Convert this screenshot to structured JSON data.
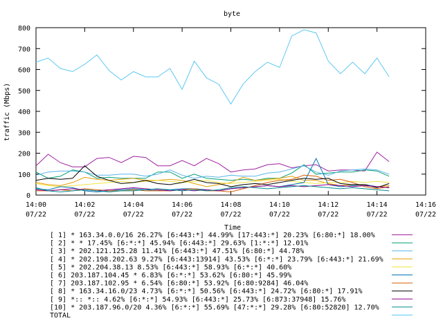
{
  "chart_data": {
    "type": "line",
    "title": "byte",
    "xlabel": "Time",
    "ylabel": "traffic (Mbps)",
    "ylim": [
      0,
      800
    ],
    "xlim": [
      "14:00",
      "14:16"
    ],
    "y_ticks": [
      0,
      100,
      200,
      300,
      400,
      500,
      600,
      700,
      800
    ],
    "x_ticks": [
      {
        "t": "14:00",
        "line2": "07/22"
      },
      {
        "t": "14:02",
        "line2": "07/22"
      },
      {
        "t": "14:04",
        "line2": "07/22"
      },
      {
        "t": "14:06",
        "line2": "07/22"
      },
      {
        "t": "14:08",
        "line2": "07/22"
      },
      {
        "t": "14:10",
        "line2": "07/22"
      },
      {
        "t": "14:12",
        "line2": "07/22"
      },
      {
        "t": "14:14",
        "line2": "07/22"
      },
      {
        "t": "14:16",
        "line2": "07/22"
      }
    ],
    "x": [
      "14:00:00",
      "14:00:30",
      "14:01:00",
      "14:01:30",
      "14:02:00",
      "14:02:30",
      "14:03:00",
      "14:03:30",
      "14:04:00",
      "14:04:30",
      "14:05:00",
      "14:05:30",
      "14:06:00",
      "14:06:30",
      "14:07:00",
      "14:07:30",
      "14:08:00",
      "14:08:30",
      "14:09:00",
      "14:09:30",
      "14:10:00",
      "14:10:30",
      "14:11:00",
      "14:11:30",
      "14:12:00",
      "14:12:30",
      "14:13:00",
      "14:13:30",
      "14:14:00",
      "14:14:30"
    ],
    "grid": false,
    "legend_position": "bottom",
    "series": [
      {
        "name": "[ 1] * 163.34.0.0/16 26.27%  [6:443:*] 44.99% [17:443:*] 20.23% [6:80:*] 18.00%",
        "color": "#a020a0",
        "values": [
          140,
          195,
          155,
          135,
          135,
          175,
          180,
          155,
          185,
          180,
          140,
          140,
          165,
          140,
          175,
          150,
          110,
          120,
          125,
          145,
          150,
          130,
          140,
          145,
          115,
          120,
          120,
          115,
          205,
          160
        ]
      },
      {
        "name": "[ 2] * * 17.45%  [6:*:*] 45.94% [6:443:*] 29.63% [1:*:*] 12.01%",
        "color": "#009e73",
        "values": [
          110,
          80,
          90,
          120,
          110,
          80,
          85,
          80,
          80,
          80,
          110,
          110,
          80,
          100,
          80,
          75,
          70,
          75,
          70,
          80,
          80,
          105,
          145,
          100,
          105,
          110,
          110,
          120,
          115,
          90
        ]
      },
      {
        "name": "[ 3] * 202.121.125.28 11.41%  [6:443:*] 47.51% [6:80:*] 44.78%",
        "color": "#56b4e9",
        "values": [
          95,
          110,
          115,
          115,
          110,
          95,
          95,
          100,
          100,
          90,
          100,
          120,
          95,
          80,
          90,
          85,
          95,
          90,
          90,
          105,
          110,
          125,
          140,
          110,
          95,
          115,
          120,
          125,
          120,
          100
        ]
      },
      {
        "name": "[ 4] * 202.198.202.63 9.27%  [6:443:13914] 43.53% [6:*:*] 23.79% [6:443:*] 21.69%",
        "color": "#e69f00",
        "values": [
          60,
          50,
          45,
          60,
          85,
          75,
          70,
          75,
          80,
          70,
          70,
          75,
          70,
          55,
          40,
          50,
          60,
          85,
          70,
          75,
          80,
          90,
          70,
          70,
          55,
          45,
          50,
          45,
          40,
          45
        ]
      },
      {
        "name": "[ 5] * 202.204.38.13 8.53%  [6:443:*] 58.93% [6:*:*] 40.60%",
        "color": "#f0e442",
        "values": [
          55,
          45,
          40,
          45,
          50,
          55,
          60,
          65,
          60,
          65,
          70,
          65,
          60,
          65,
          70,
          60,
          55,
          60,
          65,
          70,
          75,
          65,
          60,
          55,
          60,
          60,
          65,
          60,
          65,
          60
        ]
      },
      {
        "name": "[ 6] 203.187.104.45 * 6.83%  [6:*:*] 53.62% [6:80:*] 45.99%",
        "color": "#0072b2",
        "values": [
          30,
          25,
          40,
          35,
          20,
          15,
          20,
          25,
          30,
          25,
          20,
          25,
          30,
          30,
          25,
          20,
          30,
          35,
          40,
          45,
          40,
          50,
          60,
          175,
          50,
          40,
          45,
          50,
          40,
          35
        ]
      },
      {
        "name": "[ 7] 203.187.102.95 * 6.54%  [6:80:*] 53.92% [6:80:9284] 46.04%",
        "color": "#d55e00",
        "values": [
          20,
          20,
          25,
          20,
          30,
          25,
          20,
          20,
          25,
          20,
          20,
          20,
          25,
          30,
          20,
          20,
          15,
          30,
          45,
          60,
          70,
          75,
          95,
          90,
          70,
          75,
          60,
          40,
          30,
          40
        ]
      },
      {
        "name": "[ 8] * 163.34.16.0/23 4.73%  [6:*:*] 50.56% [6:443:*] 24.72% [6:80:*] 17.91%",
        "color": "#000000",
        "values": [
          70,
          80,
          75,
          80,
          140,
          90,
          70,
          55,
          60,
          70,
          55,
          50,
          60,
          75,
          60,
          55,
          40,
          50,
          55,
          50,
          60,
          70,
          80,
          75,
          80,
          55,
          50,
          50,
          35,
          55
        ]
      },
      {
        "name": "[ 9] *:: *:: 4.62%  [6:*:*] 54.93% [6:443:*] 25.73% [6:873:37948] 15.76%",
        "color": "#8b008b",
        "values": [
          25,
          20,
          25,
          30,
          25,
          20,
          25,
          30,
          35,
          30,
          25,
          20,
          25,
          20,
          25,
          20,
          30,
          35,
          40,
          45,
          40,
          45,
          40,
          45,
          50,
          45,
          40,
          45,
          40,
          35
        ]
      },
      {
        "name": "[10] * 203.187.96.0/20 4.36%  [6:*:*] 55.69% [47:*:*] 29.28% [6:80:52820] 12.70%",
        "color": "#008b8b",
        "values": [
          35,
          20,
          15,
          20,
          25,
          20,
          15,
          20,
          20,
          25,
          30,
          25,
          20,
          25,
          20,
          25,
          35,
          40,
          35,
          30,
          35,
          40,
          45,
          40,
          35,
          30,
          35,
          30,
          25,
          20
        ]
      },
      {
        "name": "TOTAL",
        "color": "#5cc8f0",
        "values": [
          635,
          655,
          605,
          590,
          625,
          670,
          595,
          550,
          590,
          565,
          565,
          605,
          505,
          640,
          560,
          530,
          435,
          530,
          590,
          635,
          610,
          760,
          790,
          775,
          640,
          580,
          635,
          580,
          655,
          565
        ]
      }
    ]
  }
}
